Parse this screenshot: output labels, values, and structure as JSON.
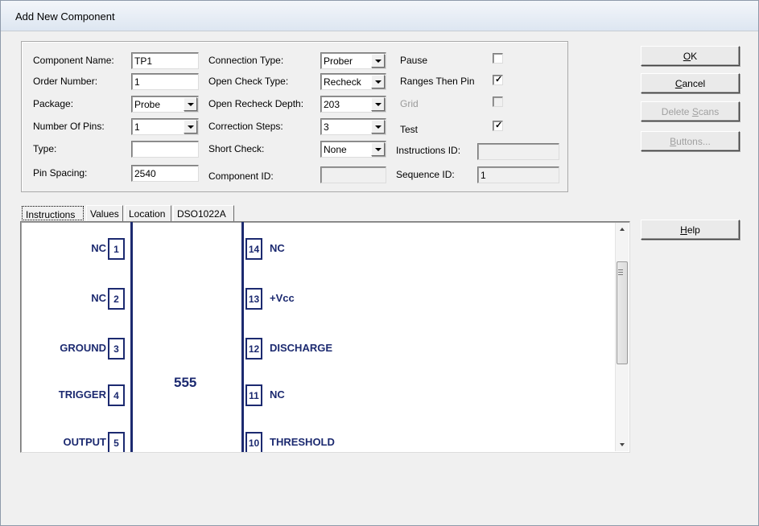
{
  "window": {
    "title": "Add New Component"
  },
  "fields": {
    "component_name": {
      "label": "Component Name:",
      "value": "TP1"
    },
    "order_number": {
      "label": "Order Number:",
      "value": "1"
    },
    "package": {
      "label": "Package:",
      "value": "Probe"
    },
    "number_of_pins": {
      "label": "Number Of Pins:",
      "value": "1"
    },
    "type": {
      "label": "Type:",
      "value": ""
    },
    "pin_spacing": {
      "label": "Pin Spacing:",
      "value": "2540"
    },
    "connection_type": {
      "label": "Connection Type:",
      "value": "Prober"
    },
    "open_check_type": {
      "label": "Open Check Type:",
      "value": "Recheck"
    },
    "open_recheck_depth": {
      "label": "Open Recheck Depth:",
      "value": "203"
    },
    "correction_steps": {
      "label": "Correction Steps:",
      "value": "3"
    },
    "short_check": {
      "label": "Short Check:",
      "value": "None"
    },
    "component_id": {
      "label": "Component ID:",
      "value": ""
    },
    "pause": {
      "label": "Pause",
      "checked": false
    },
    "ranges_then_pin": {
      "label": "Ranges Then Pin",
      "checked": true
    },
    "grid": {
      "label": "Grid",
      "checked": false,
      "enabled": false
    },
    "test": {
      "label": "Test",
      "checked": true
    },
    "instructions_id": {
      "label": "Instructions ID:",
      "value": ""
    },
    "sequence_id": {
      "label": "Sequence ID:",
      "value": "1"
    }
  },
  "buttons": {
    "ok": {
      "mnemonic": "O",
      "rest": "K"
    },
    "cancel": {
      "mnemonic": "C",
      "rest": "ancel"
    },
    "delete_scans": {
      "pre": "Delete ",
      "mnemonic": "S",
      "rest": "cans"
    },
    "buttons": {
      "mnemonic": "B",
      "rest": "uttons..."
    },
    "help": {
      "mnemonic": "H",
      "rest": "elp"
    }
  },
  "tabs": [
    "Instructions",
    "Values",
    "Location",
    "DSO1022A"
  ],
  "chip": {
    "name": "555",
    "left_pins": [
      {
        "num": "1",
        "name": "NC"
      },
      {
        "num": "2",
        "name": "NC"
      },
      {
        "num": "3",
        "name": "GROUND"
      },
      {
        "num": "4",
        "name": "TRIGGER"
      },
      {
        "num": "5",
        "name": "OUTPUT"
      }
    ],
    "right_pins": [
      {
        "num": "14",
        "name": "NC"
      },
      {
        "num": "13",
        "name": "+Vcc"
      },
      {
        "num": "12",
        "name": "DISCHARGE"
      },
      {
        "num": "11",
        "name": "NC"
      },
      {
        "num": "10",
        "name": "THRESHOLD"
      }
    ]
  },
  "colors": {
    "diagram": "#1c2a70"
  }
}
